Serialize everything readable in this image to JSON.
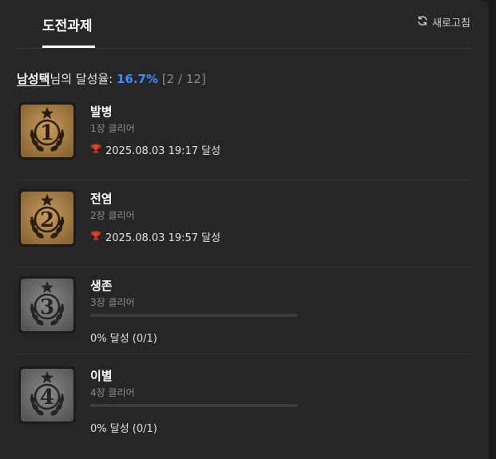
{
  "tab": {
    "label": "도전과제"
  },
  "refresh": {
    "label": "새로고침",
    "icon": "refresh-icon"
  },
  "rate": {
    "user": "남성택",
    "middle": "님의 달성율: ",
    "percent": "16.7%",
    "count": "[2 / 12]"
  },
  "colors": {
    "accent": "#3d8bff",
    "trophy": "#e8401c",
    "gold_badge": "#b08a52",
    "gray_badge": "#7a7a7a"
  },
  "achievements": [
    {
      "title": "발병",
      "subtitle": "1장 클리어",
      "number": "1",
      "completed": true,
      "completed_text": "2025.08.03 19:17 달성",
      "icon": "trophy-icon"
    },
    {
      "title": "전염",
      "subtitle": "2장 클리어",
      "number": "2",
      "completed": true,
      "completed_text": "2025.08.03 19:57 달성",
      "icon": "trophy-icon"
    },
    {
      "title": "생존",
      "subtitle": "3장 클리어",
      "number": "3",
      "completed": false,
      "progress": 0,
      "progress_text": "0% 달성 (0/1)"
    },
    {
      "title": "이별",
      "subtitle": "4장 클리어",
      "number": "4",
      "completed": false,
      "progress": 0,
      "progress_text": "0% 달성 (0/1)"
    }
  ]
}
